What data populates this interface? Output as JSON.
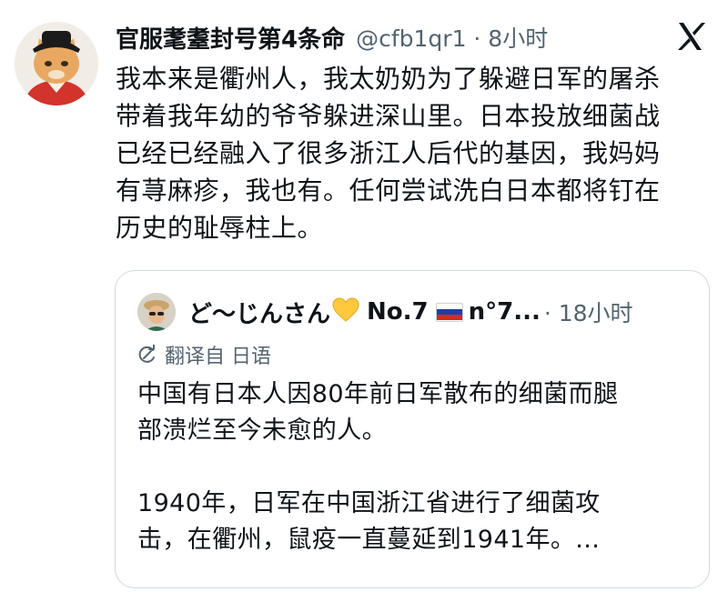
{
  "tweet": {
    "author_name": "官服耄耋封号第4条命",
    "meta": "@cfb1qr1 · 8小时",
    "text_lines": [
      "我本来是衢州人，我太奶奶为了躲避日军的屠杀",
      "带着我年幼的爷爷躲进深山里。日本投放细菌战",
      "已经已经融入了很多浙江人后代的基因，我妈妈",
      "有荨麻疹，我也有。任何尝试洗白日本都将钉在",
      "历史的耻辱柱上。"
    ]
  },
  "quoted": {
    "author_name": "ど～じんさん",
    "emoji": "💛",
    "badge": "No.7",
    "badge_suffix": "n°7...",
    "time": "· 18小时",
    "translate_label": "翻译自 日语",
    "text_lines": [
      "中国有日本人因80年前日军散布的细菌而腿",
      "部溃烂至今未愈的人。",
      "",
      "1940年，日军在中国浙江省进行了细菌攻",
      "击，在衢州，鼠疫一直蔓延到1941年。..."
    ]
  },
  "colors": {
    "text": "#0f1419",
    "secondary": "#536471",
    "border": "#cfd9de",
    "heart": "#ffc83d"
  },
  "icons": {
    "platform": "x-logo-icon",
    "translate": "translate-icon",
    "flag": "russia-flag-icon"
  }
}
